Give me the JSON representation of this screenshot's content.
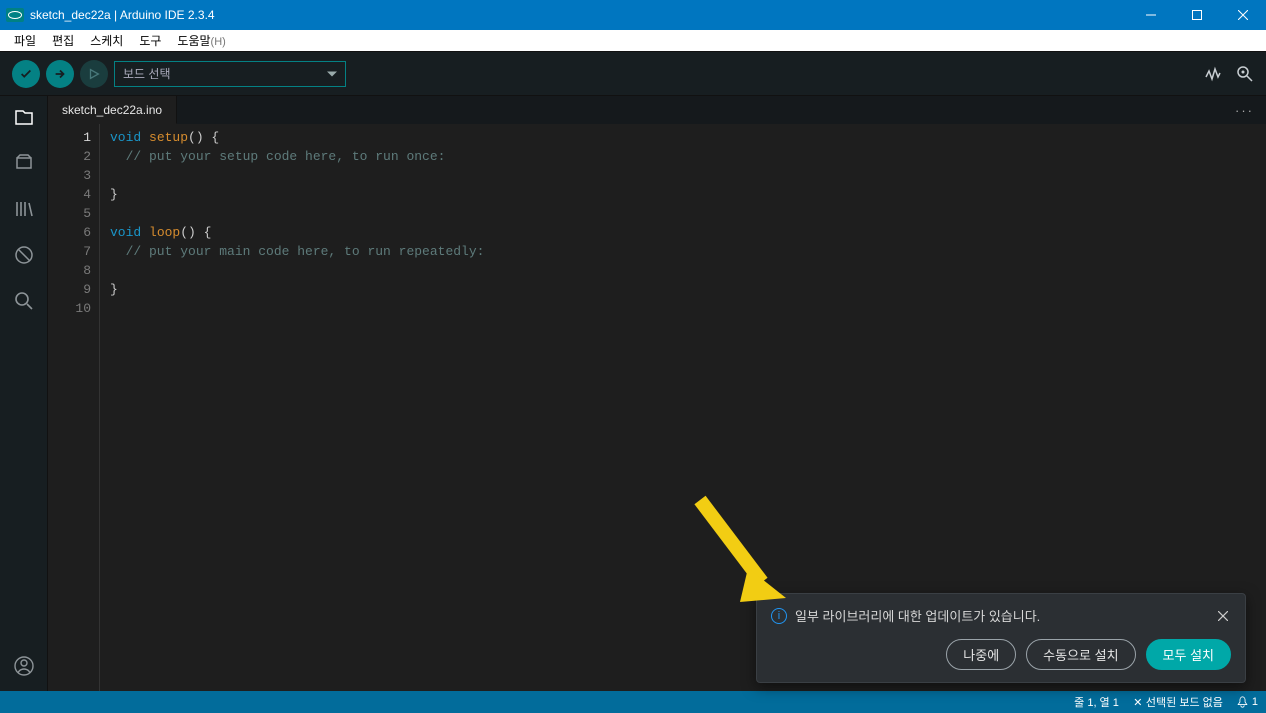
{
  "window": {
    "title": "sketch_dec22a | Arduino IDE 2.3.4"
  },
  "menu": {
    "file": "파일",
    "edit": "편집",
    "sketch": "스케치",
    "tools": "도구",
    "help": "도움말",
    "help_key": "(H)"
  },
  "toolbar": {
    "board_placeholder": "보드 선택"
  },
  "tab": {
    "name": "sketch_dec22a.ino"
  },
  "code": {
    "current_line": 1,
    "lines": [
      {
        "n": 1,
        "t": "kw",
        "a": "void ",
        "b": "setup",
        "c": "() {"
      },
      {
        "n": 2,
        "cm": "  // put your setup code here, to run once:"
      },
      {
        "n": 3,
        "blank": true
      },
      {
        "n": 4,
        "pn": "}"
      },
      {
        "n": 5,
        "blank": true
      },
      {
        "n": 6,
        "t": "kw",
        "a": "void ",
        "b": "loop",
        "c": "() {"
      },
      {
        "n": 7,
        "cm": "  // put your main code here, to run repeatedly:"
      },
      {
        "n": 8,
        "blank": true
      },
      {
        "n": 9,
        "pn": "}"
      },
      {
        "n": 10,
        "blank": true
      }
    ]
  },
  "toast": {
    "message": "일부 라이브러리에 대한 업데이트가 있습니다.",
    "later": "나중에",
    "manual": "수동으로 설치",
    "all": "모두 설치"
  },
  "status": {
    "cursor": "줄 1, 열 1",
    "board": "선택된 보드 없음",
    "notif_count": "1"
  }
}
